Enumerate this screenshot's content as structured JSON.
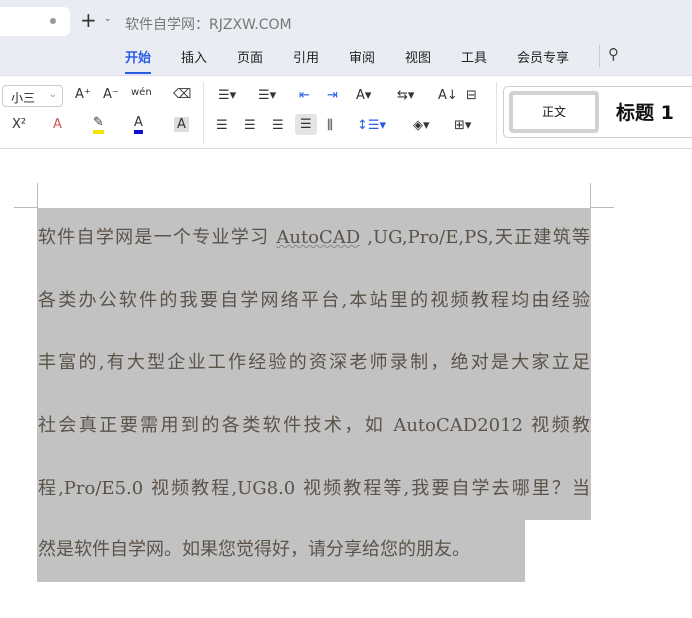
{
  "titlebar": {
    "new_tab": "+",
    "title": "软件自学网：RJZXW.COM"
  },
  "ribbon_tabs": [
    "开始",
    "插入",
    "页面",
    "引用",
    "审阅",
    "视图",
    "工具",
    "会员专享"
  ],
  "active_tab": "开始",
  "toolbar": {
    "font_size": "小三",
    "grow": "A⁺",
    "shrink": "A⁻",
    "pinyin": "wén",
    "clear": "⌫",
    "superscript": "X²",
    "text_effect": "A",
    "highlight": "✎",
    "font_color": "A",
    "char_shade": "A",
    "accent_highlight": "#f5e400",
    "accent_fontcolor": "#1010d0",
    "styles": {
      "normal": "正文",
      "heading1": "标题 1"
    }
  },
  "document": {
    "lines": [
      [
        "软件自学网是一个专业学习 ",
        "AutoCAD",
        " ,UG,Pro/E,PS,天正建筑等"
      ],
      [
        "各类办公软件的我要自学网络平台,本站里的视频教程均由经验"
      ],
      [
        "丰富的,有大型企业工作经验的资深老师录制，绝对是大家立足"
      ],
      [
        "社会真正要需用到的各类软件技术，如 AutoCAD2012 视频教"
      ],
      [
        "程,Pro/E5.0 视频教程,UG8.0 视频教程等,我要自学去哪里？当"
      ],
      [
        "然是软件自学网。如果您觉得好，请分享给您的朋友。"
      ]
    ]
  }
}
